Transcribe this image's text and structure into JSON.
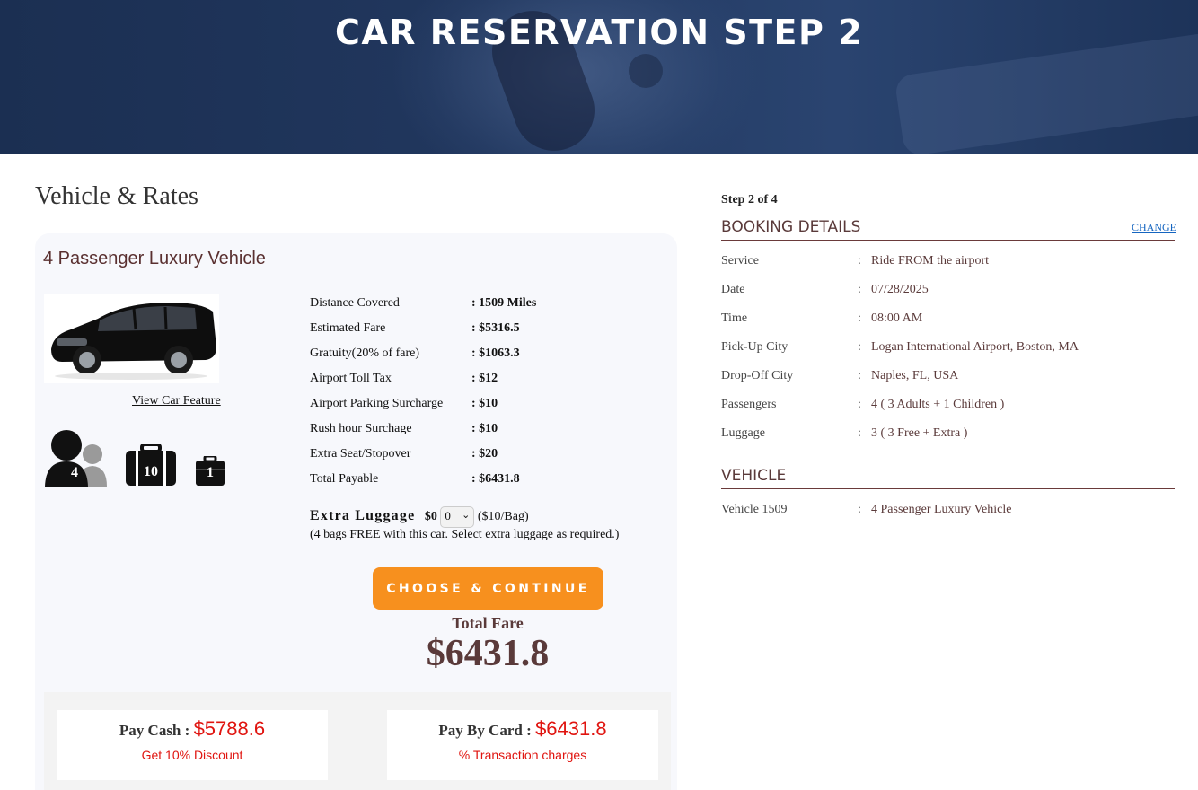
{
  "hero": {
    "title": "CAR RESERVATION STEP 2"
  },
  "left": {
    "section_title": "Vehicle & Rates",
    "vehicle_name": "4 Passenger Luxury Vehicle",
    "view_feature_link": "View Car Feature",
    "capacity": {
      "passengers": "4",
      "large_bags": "10",
      "small_bags": "1"
    },
    "rates": [
      {
        "label": "Distance Covered",
        "value": ": 1509 Miles"
      },
      {
        "label": "Estimated Fare",
        "value": ": $5316.5"
      },
      {
        "label": "Gratuity(20% of fare)",
        "value": ": $1063.3"
      },
      {
        "label": "Airport Toll Tax",
        "value": ": $12"
      },
      {
        "label": "Airport Parking Surcharge",
        "value": ": $10"
      },
      {
        "label": "Rush hour Surchage",
        "value": ": $10"
      },
      {
        "label": "Extra Seat/Stopover",
        "value": ": $20"
      },
      {
        "label": "Total Payable",
        "value": ": $6431.8"
      }
    ],
    "extra_luggage": {
      "title": "Extra Luggage",
      "amount": "$0",
      "selected": "0",
      "rate": "($10/Bag)",
      "note": "(4 bags FREE with this car. Select extra luggage as required.)"
    },
    "choose_button": "CHOOSE & CONTINUE",
    "total_fare_label": "Total Fare",
    "total_fare_value": "$6431.8",
    "pay_cash": {
      "label": "Pay Cash :",
      "amount": "$5788.6",
      "note": "Get 10% Discount"
    },
    "pay_card": {
      "label": "Pay By Card :",
      "amount": "$6431.8",
      "note": "% Transaction charges"
    }
  },
  "right": {
    "step": "Step 2 of 4",
    "booking_heading": "BOOKING DETAILS",
    "change_link": "CHANGE",
    "details": [
      {
        "label": "Service",
        "sep": ":",
        "value": "Ride FROM the airport"
      },
      {
        "label": "Date",
        "sep": ":",
        "value": "07/28/2025"
      },
      {
        "label": "Time",
        "sep": ":",
        "value": "08:00 AM"
      },
      {
        "label": "Pick-Up City",
        "sep": ":",
        "value": "Logan International Airport, Boston, MA"
      },
      {
        "label": "Drop-Off City",
        "sep": ":",
        "value": "Naples, FL, USA"
      },
      {
        "label": "Passengers",
        "sep": ":",
        "value": "4 ( 3 Adults + 1 Children )"
      },
      {
        "label": "Luggage",
        "sep": ":",
        "value": "3 ( 3 Free + Extra )"
      }
    ],
    "vehicle_heading": "VEHICLE",
    "vehicle_row": {
      "label": "Vehicle 1509",
      "sep": ":",
      "value": "4 Passenger Luxury Vehicle"
    }
  },
  "colors": {
    "accent_orange": "#f7901e",
    "price_red": "#e0140f",
    "brown": "#5a3a3a",
    "hero_navy": "#1b2f52"
  },
  "icons": [
    "passengers-icon",
    "large-luggage-icon",
    "small-luggage-icon",
    "chevron-down-icon"
  ]
}
